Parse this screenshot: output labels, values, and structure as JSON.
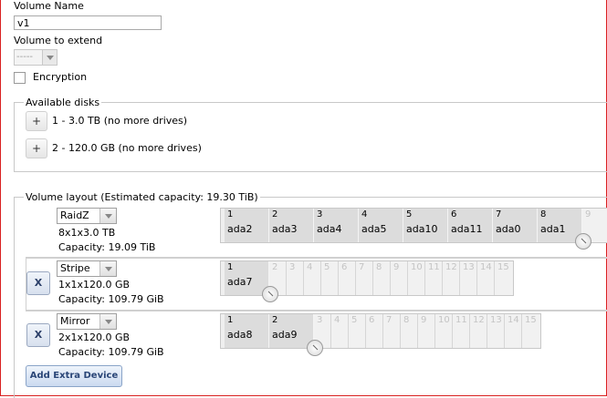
{
  "form": {
    "volume_name_label": "Volume Name",
    "volume_name_value": "v1",
    "volume_extend_label": "Volume to extend",
    "volume_extend_value": "-----",
    "encryption_label": "Encryption",
    "available_disks_legend": "Available disks",
    "available_disks": [
      {
        "text": "1 - 3.0 TB (no more drives)"
      },
      {
        "text": "2 - 120.0 GB (no more drives)"
      }
    ],
    "layout_legend": "Volume layout (Estimated capacity: 19.30 TiB)",
    "vdevs": [
      {
        "type": "RaidZ",
        "layout": "8x1x3.0 TB",
        "capacity": "Capacity: 19.09 TiB",
        "columns_on": [
          "1",
          "2",
          "3",
          "4",
          "5",
          "6",
          "7",
          "8"
        ],
        "disks": [
          "ada2",
          "ada3",
          "ada4",
          "ada5",
          "ada10",
          "ada11",
          "ada0",
          "ada1"
        ],
        "columns_off": [
          "9"
        ],
        "has_remove": false
      },
      {
        "type": "Stripe",
        "layout": "1x1x120.0 GB",
        "capacity": "Capacity: 109.79 GiB",
        "columns_on": [
          "1"
        ],
        "disks": [
          "ada7"
        ],
        "columns_off": [
          "2",
          "3",
          "4",
          "5",
          "6",
          "7",
          "8",
          "9",
          "10",
          "11",
          "12",
          "13",
          "14",
          "15"
        ],
        "has_remove": true
      },
      {
        "type": "Mirror",
        "layout": "2x1x120.0 GB",
        "capacity": "Capacity: 109.79 GiB",
        "columns_on": [
          "1",
          "2"
        ],
        "disks": [
          "ada8",
          "ada9"
        ],
        "columns_off": [
          "3",
          "4",
          "5",
          "6",
          "7",
          "8",
          "9",
          "10",
          "11",
          "12",
          "13",
          "14",
          "15"
        ],
        "has_remove": true
      }
    ],
    "plus_label": "+",
    "remove_label": "X",
    "add_extra_label": "Add Extra Device"
  }
}
